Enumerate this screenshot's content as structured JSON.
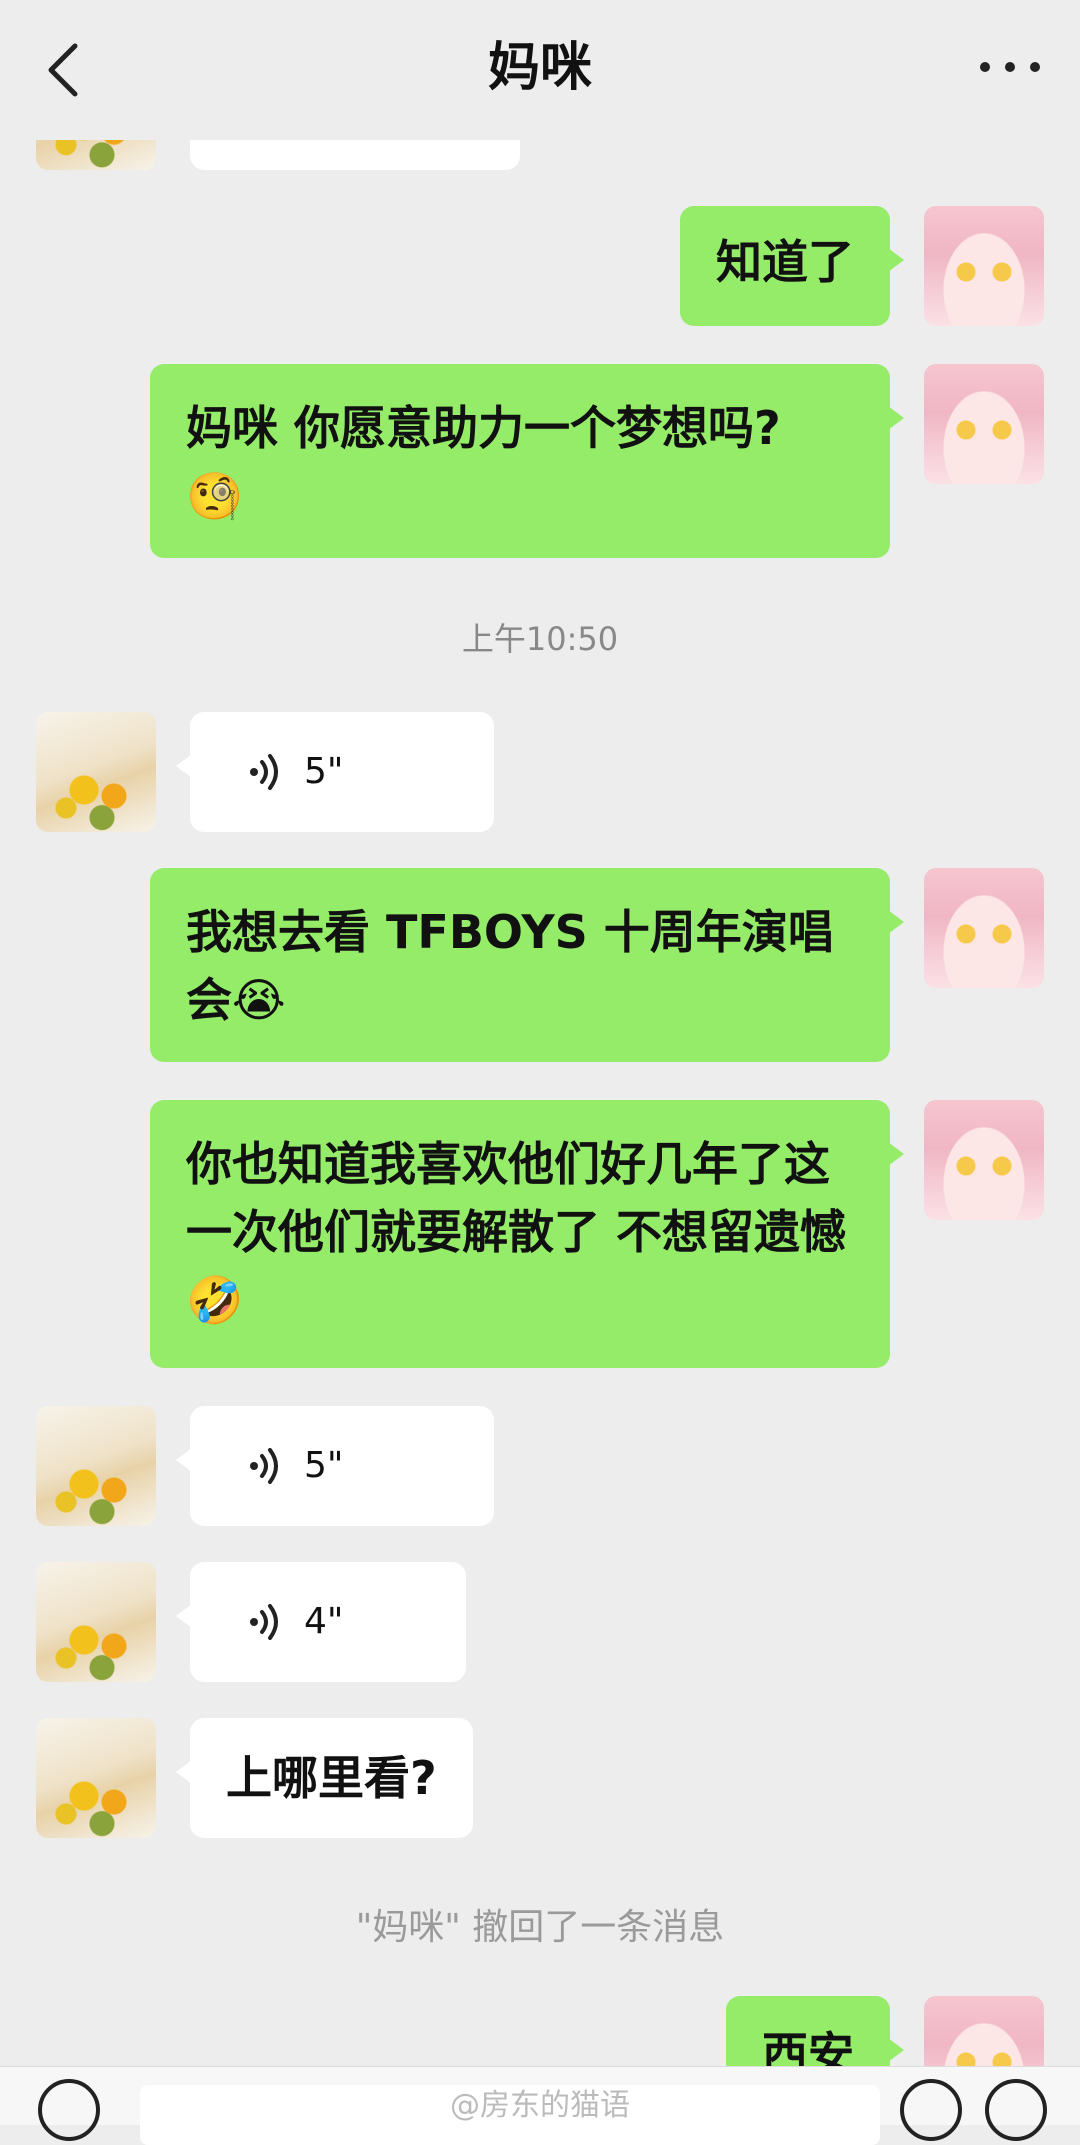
{
  "header": {
    "title": "妈咪"
  },
  "messages": {
    "m1": "知道了",
    "m2_text": "妈咪  你愿意助力一个梦想吗?",
    "m2_emoji": "🧐",
    "time": "上午10:50",
    "v1": "5\"",
    "m3_text": "我想去看 TFBOYS 十周年演唱会",
    "m3_emoji": "😭",
    "m4_text": "你也知道我喜欢他们好几年了这一次他们就要解散了 不想留遗憾",
    "m4_emoji": "🤣",
    "v2": "5\"",
    "v3": "4\"",
    "m5": "上哪里看?",
    "recall": "\"妈咪\" 撤回了一条消息",
    "m6": "西安"
  },
  "watermark": "@房东的猫语",
  "colors": {
    "background": "#ededed",
    "my_bubble": "#95ec69",
    "their_bubble": "#ffffff"
  }
}
